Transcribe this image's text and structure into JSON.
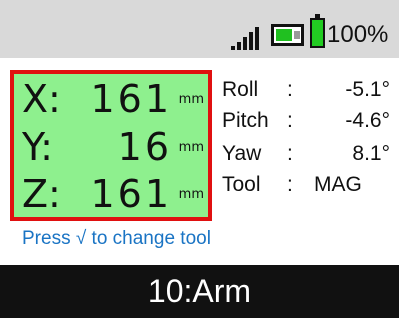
{
  "status": {
    "battery_percent": "100%",
    "signal_icon": "signal-bars-icon",
    "link_icon": "link-status-icon",
    "battery_icon": "battery-icon"
  },
  "coords": {
    "x": {
      "axis": "X",
      "colon": ":",
      "value": "161",
      "unit": "mm"
    },
    "y": {
      "axis": "Y",
      "colon": ":",
      "value": "16",
      "unit": "mm"
    },
    "z": {
      "axis": "Z",
      "colon": ":",
      "value": "161",
      "unit": "mm"
    }
  },
  "orientation": {
    "roll": {
      "label": "Roll",
      "value": "-5.1°"
    },
    "pitch": {
      "label": "Pitch",
      "value": "-4.6°"
    },
    "yaw": {
      "label": "Yaw",
      "value": "8.1°"
    },
    "tool": {
      "label": "Tool",
      "value": "MAG"
    }
  },
  "hint": "Press √ to change tool",
  "footer_title": "10:Arm",
  "colors": {
    "coord_bg": "#8ef08e",
    "coord_border": "#e01010",
    "hint_text": "#1a74c4",
    "footer_bg": "#111111",
    "status_bg": "#d9d9d9"
  }
}
